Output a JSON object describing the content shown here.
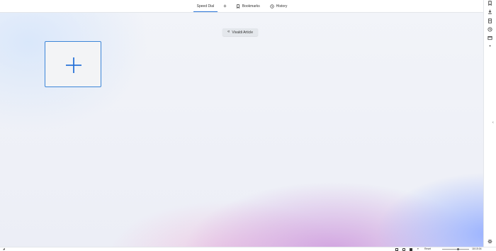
{
  "tabs": [
    {
      "label": "Speed Dial",
      "active": true
    },
    {
      "label": "Bookmarks",
      "active": false,
      "icon": "bookmark-icon"
    },
    {
      "label": "History",
      "active": false,
      "icon": "history-icon"
    }
  ],
  "tab_add_label": "+",
  "article_button": {
    "label": "Vivaldi Article",
    "icon": "chevrons-left-icon"
  },
  "speed_dial": {
    "add_tile_icon": "plus-icon"
  },
  "side_panel": {
    "icons": [
      "bookmark-icon",
      "download-icon",
      "notes-icon",
      "history-icon",
      "window-icon"
    ],
    "more_label": "•"
  },
  "statusbar": {
    "zoom_label": "Reset",
    "clock": "18:15:04"
  },
  "colors": {
    "accent": "#2a73d8",
    "tile_border": "#3d86d8",
    "gradient_purple": "#cd96dc",
    "gradient_blue": "#96afff"
  }
}
